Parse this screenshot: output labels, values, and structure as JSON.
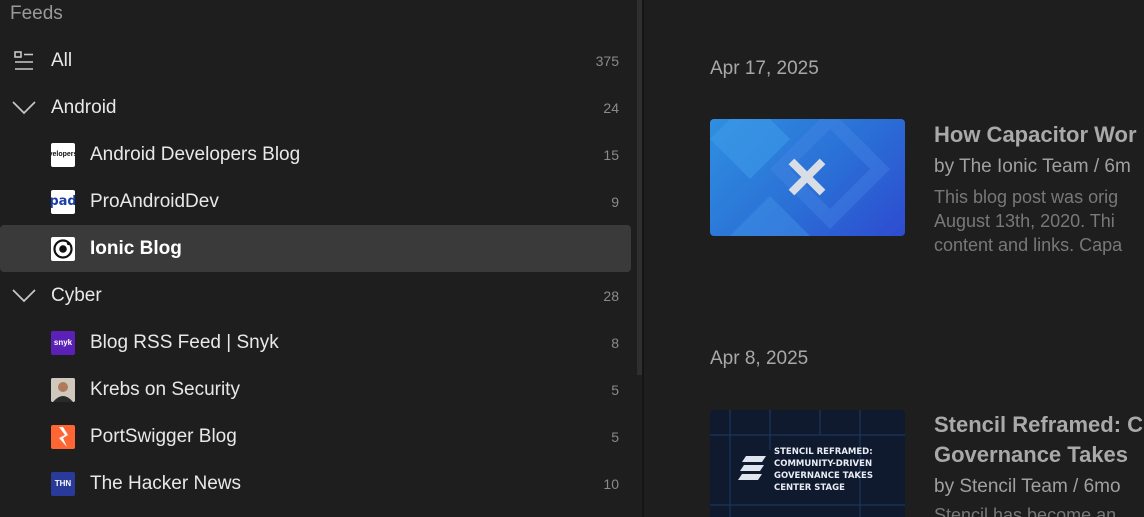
{
  "sidebar": {
    "title": "Feeds",
    "all": {
      "label": "All",
      "count": "375"
    },
    "groups": [
      {
        "label": "Android",
        "count": "24",
        "feeds": [
          {
            "label": "Android Developers Blog",
            "count": "15",
            "icon": "android-developers-favicon",
            "icon_text": "velopers"
          },
          {
            "label": "ProAndroidDev",
            "count": "9",
            "icon": "proandroiddev-favicon",
            "icon_text": "pad"
          },
          {
            "label": "Ionic Blog",
            "count": "",
            "icon": "ionic-favicon",
            "selected": true
          }
        ]
      },
      {
        "label": "Cyber",
        "count": "28",
        "feeds": [
          {
            "label": "Blog RSS Feed | Snyk",
            "count": "8",
            "icon": "snyk-favicon",
            "icon_text": "snyk"
          },
          {
            "label": "Krebs on Security",
            "count": "5",
            "icon": "krebs-portrait-favicon"
          },
          {
            "label": "PortSwigger Blog",
            "count": "5",
            "icon": "portswigger-favicon"
          },
          {
            "label": "The Hacker News",
            "count": "10",
            "icon": "thehackernews-favicon",
            "icon_text": "THN"
          }
        ]
      }
    ]
  },
  "articles": [
    {
      "date": "Apr 17, 2025",
      "title": "How Capacitor Wor",
      "meta": "by The Ionic Team / 6m",
      "summary": "This blog post was orig\nAugust 13th, 2020. Thi\ncontent and links. Capa",
      "thumbnail": "capacitor-logo-thumbnail"
    },
    {
      "date": "Apr 8, 2025",
      "title": "Stencil Reframed: C\nGovernance Takes",
      "meta": "by Stencil Team / 6mo",
      "summary": "Stencil has become an",
      "thumbnail": "stencil-reframed-thumbnail",
      "thumb_text": "STENCIL REFRAMED:\nCOMMUNITY-DRIVEN\nGOVERNANCE TAKES\nCENTER STAGE"
    }
  ],
  "colors": {
    "background": "#1e1e1e",
    "selected_row": "#3a3a3a",
    "ionic_blue": "#3880ff",
    "snyk_purple": "#4c1d95",
    "portswigger_orange": "#ff6633",
    "thn_blue": "#1e3a8a"
  }
}
